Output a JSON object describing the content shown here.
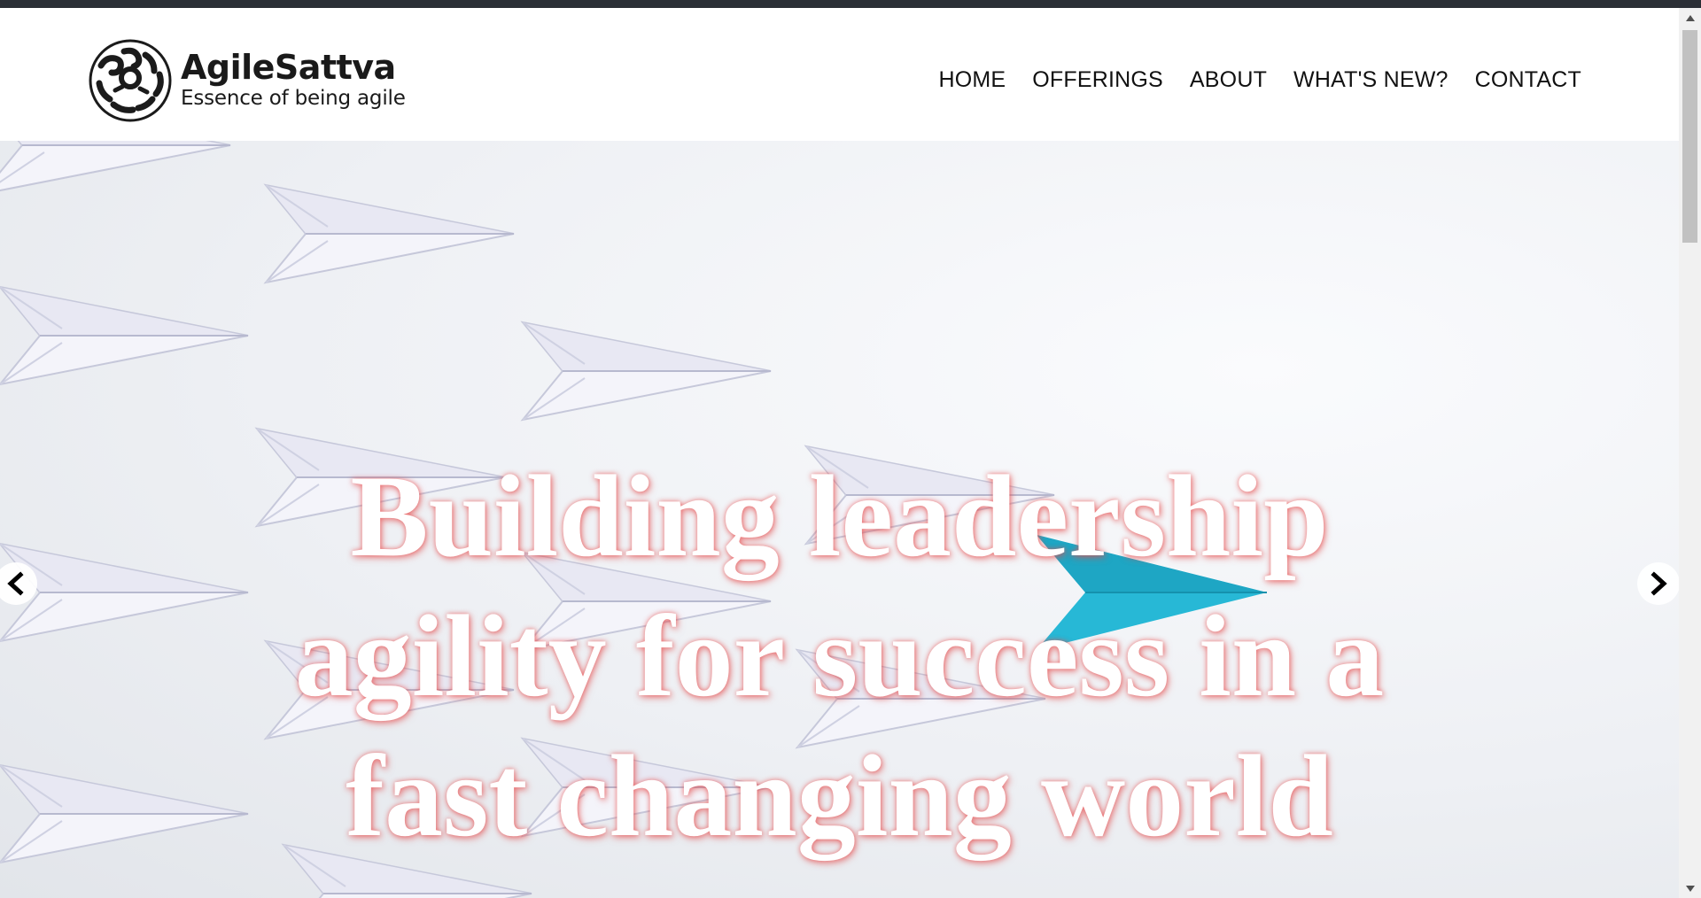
{
  "header": {
    "brand_name": "AgileSattva",
    "tagline": "Essence of being agile",
    "logo_icon": "agilesattva-logo-icon"
  },
  "nav": {
    "items": [
      {
        "label": "HOME"
      },
      {
        "label": "OFFERINGS"
      },
      {
        "label": "ABOUT"
      },
      {
        "label": "WHAT'S NEW?"
      },
      {
        "label": "CONTACT"
      }
    ]
  },
  "hero": {
    "heading": "Building leadership agility for success in a fast changing world",
    "prev_icon": "chevron-left-icon",
    "next_icon": "chevron-right-icon",
    "colors": {
      "leader_plane": "#27b8d6",
      "paper_plane": "#f2f2f8",
      "heading_glow": "#e85050"
    }
  }
}
